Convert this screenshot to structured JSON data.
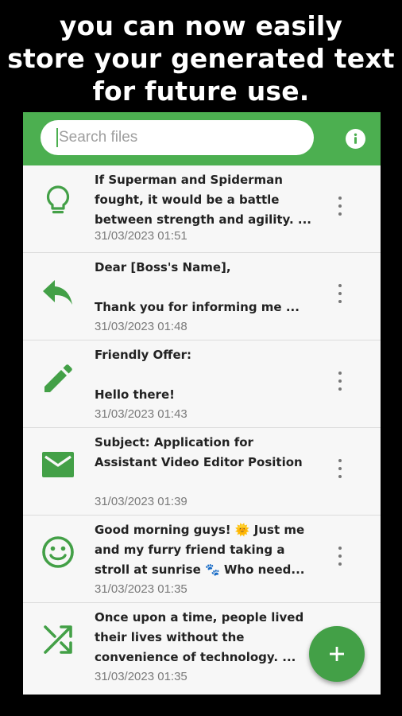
{
  "banner": {
    "line1": "you can now easily",
    "line2": "store your generated text",
    "line3": "for future use."
  },
  "search": {
    "placeholder": "Search files"
  },
  "header": {
    "info_icon": "info-icon"
  },
  "files": [
    {
      "icon": "lightbulb-icon",
      "lines": [
        "If Superman and Spiderman",
        "fought, it would be a battle",
        "between strength and agility. ..."
      ],
      "date": "31/03/2023 01:51"
    },
    {
      "icon": "reply-icon",
      "lines": [
        "Dear [Boss's Name],",
        "",
        "Thank you for informing me ..."
      ],
      "date": "31/03/2023 01:48"
    },
    {
      "icon": "pencil-icon",
      "lines": [
        "Friendly Offer:",
        "",
        "Hello there!"
      ],
      "date": "31/03/2023 01:43"
    },
    {
      "icon": "email-icon",
      "lines": [
        "Subject: Application for",
        "Assistant Video Editor Position",
        ""
      ],
      "date": "31/03/2023 01:39"
    },
    {
      "icon": "smiley-icon",
      "lines": [
        "Good morning guys! 🌞 Just me",
        "and my furry friend taking a",
        "stroll at sunrise 🐾 Who need..."
      ],
      "date": "31/03/2023 01:35"
    },
    {
      "icon": "shuffle-icon",
      "lines": [
        "Once upon a time, people lived",
        "their lives without the",
        "convenience of technology. ..."
      ],
      "date": "31/03/2023 01:35"
    }
  ],
  "fab": {
    "icon": "plus-icon"
  },
  "colors": {
    "accent": "#4caf50",
    "fab": "#43a047",
    "background": "#000000"
  }
}
